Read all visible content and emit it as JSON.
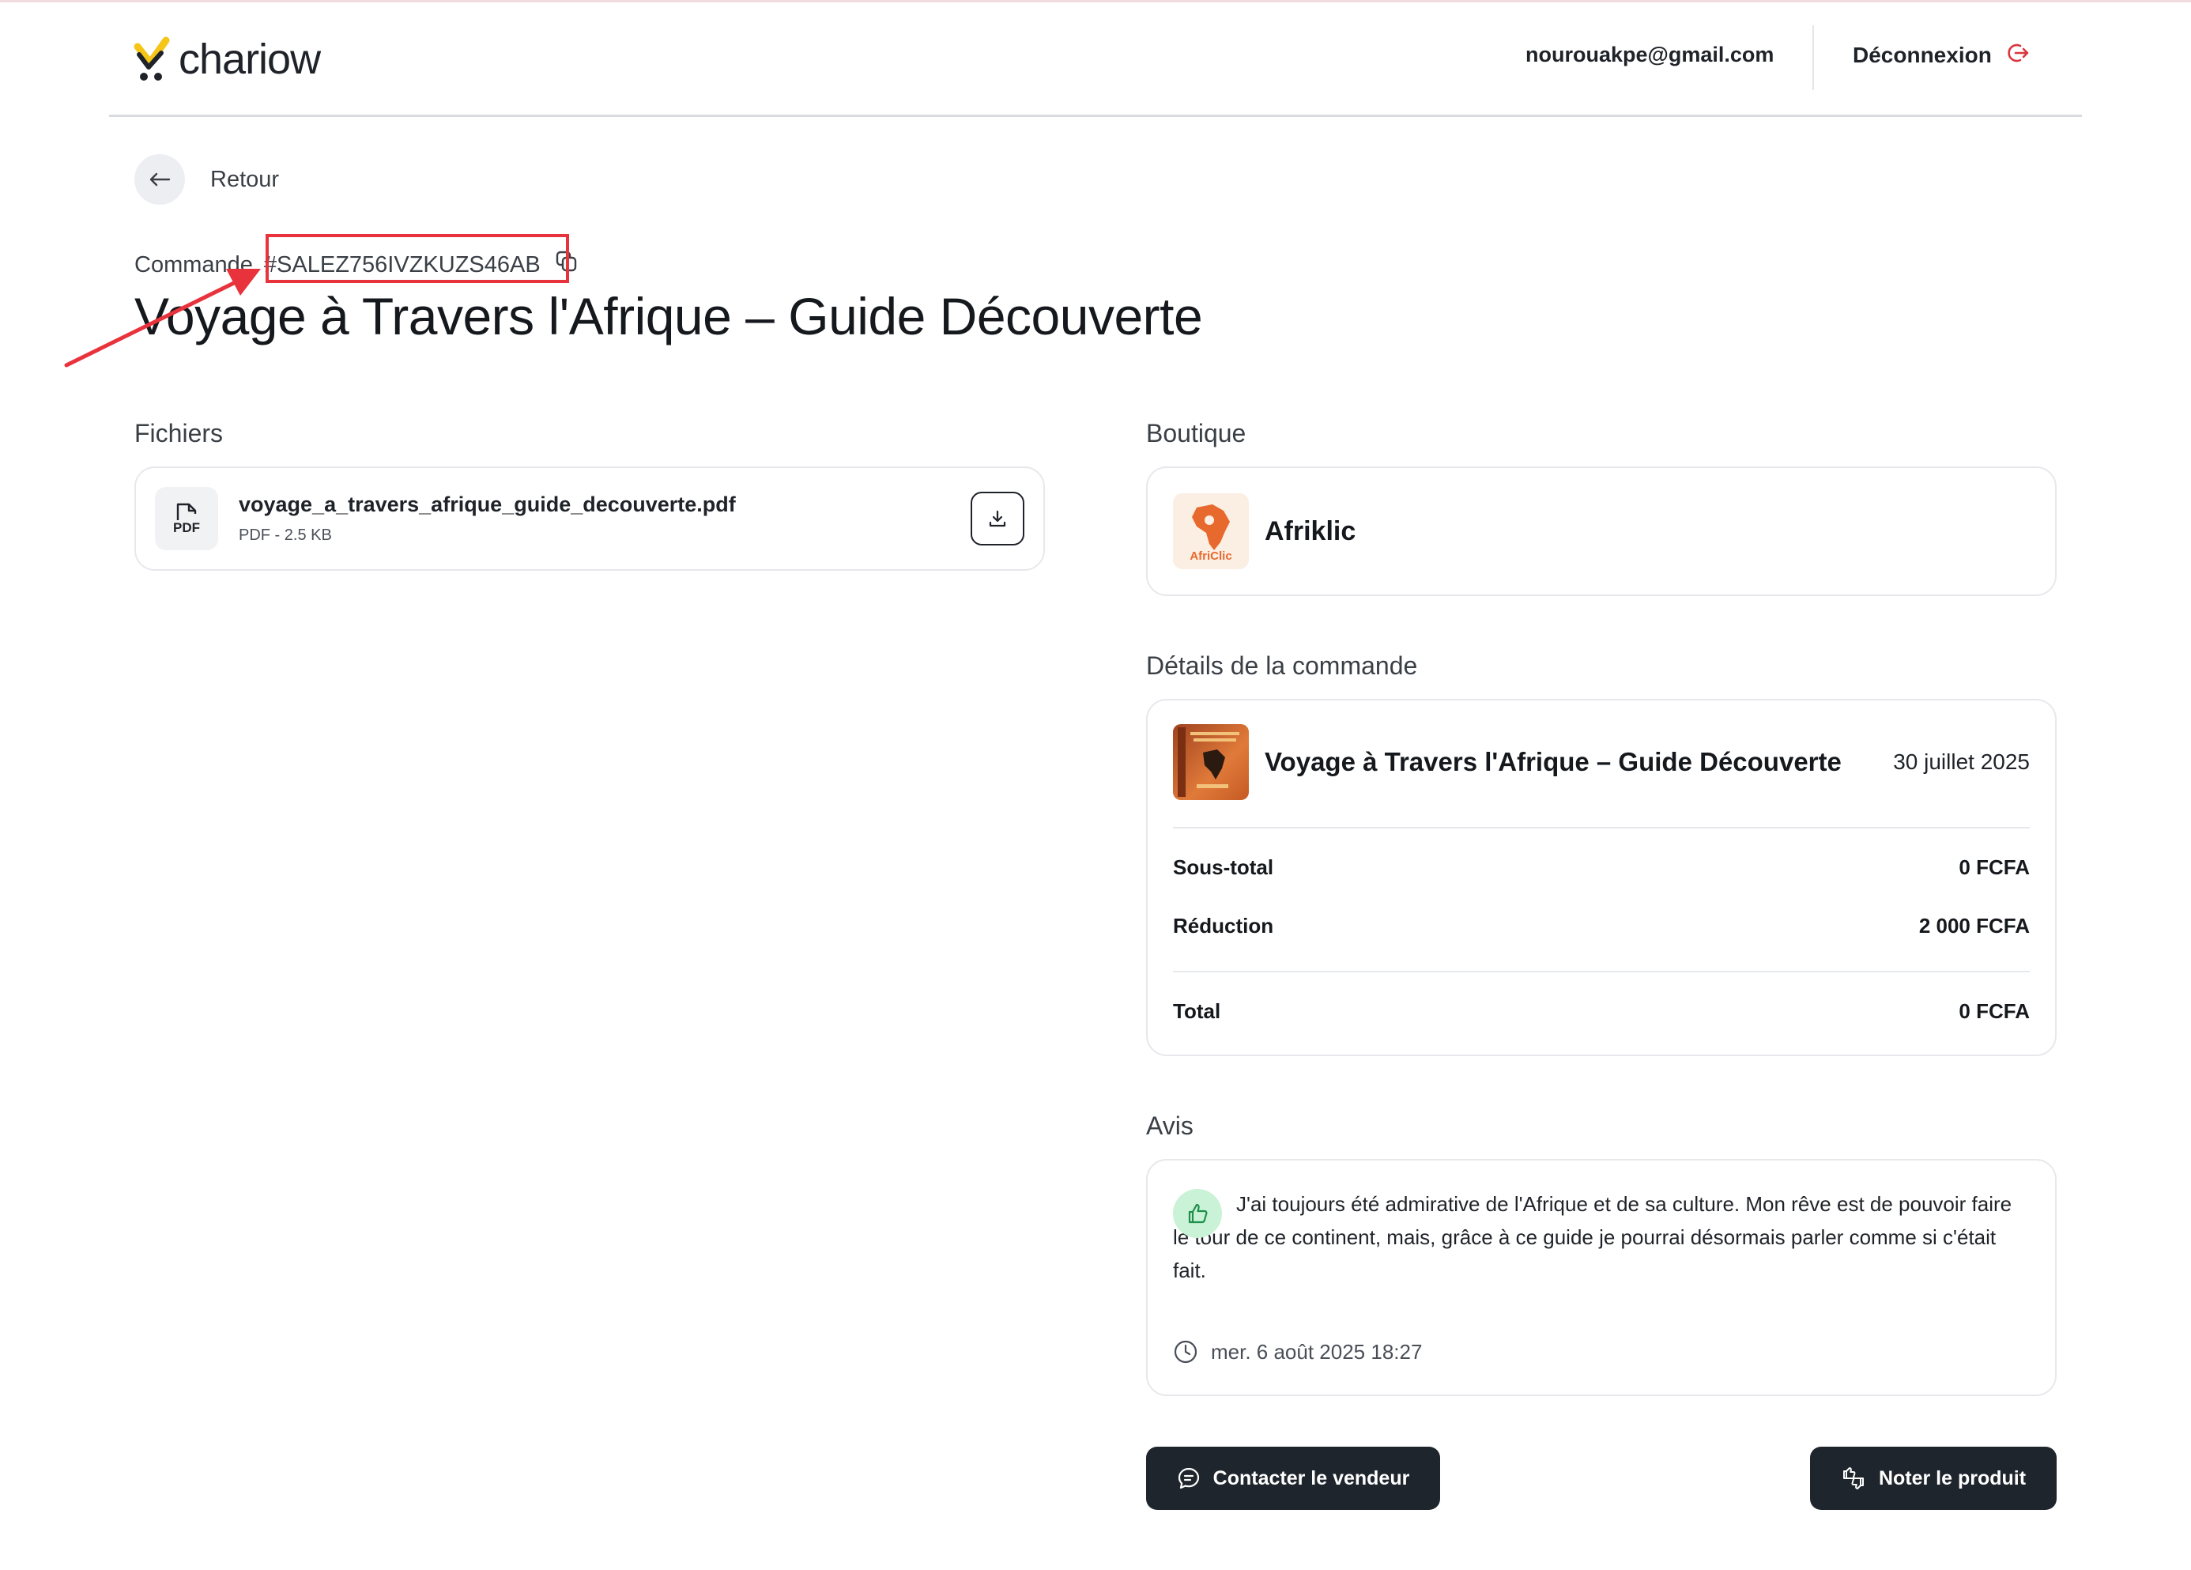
{
  "header": {
    "brand": "chariow",
    "email": "nourouakpe@gmail.com",
    "logout_label": "Déconnexion"
  },
  "back_label": "Retour",
  "order": {
    "prefix": "Commande",
    "id": "#SALEZ756IVZKUZS46AB",
    "title": "Voyage à Travers l'Afrique – Guide Découverte"
  },
  "files": {
    "section_label": "Fichiers",
    "items": [
      {
        "name": "voyage_a_travers_afrique_guide_decouverte.pdf",
        "meta": "PDF - 2.5 KB",
        "icon_label": "PDF"
      }
    ]
  },
  "shop": {
    "section_label": "Boutique",
    "name": "Afriklic",
    "logo_text": "AfriClic"
  },
  "details": {
    "section_label": "Détails de la commande",
    "product_name": "Voyage à Travers l'Afrique – Guide Découverte",
    "date": "30 juillet 2025",
    "subtotal_label": "Sous-total",
    "subtotal_value": "0 FCFA",
    "discount_label": "Réduction",
    "discount_value": "2 000 FCFA",
    "total_label": "Total",
    "total_value": "0 FCFA"
  },
  "review": {
    "section_label": "Avis",
    "text": "J'ai toujours été admirative de l'Afrique et de sa culture. Mon rêve est de pouvoir faire le tour de ce continent, mais, grâce à ce guide je pourrai désormais parler comme si c'était fait.",
    "date": "mer. 6 août 2025 18:27"
  },
  "actions": {
    "contact_label": "Contacter le vendeur",
    "rate_label": "Noter le produit"
  },
  "colors": {
    "accent_dark": "#1f252c",
    "annotation_red": "#e8323c",
    "logo_yellow": "#f5c518",
    "review_green_bg": "#c9f2d6"
  }
}
